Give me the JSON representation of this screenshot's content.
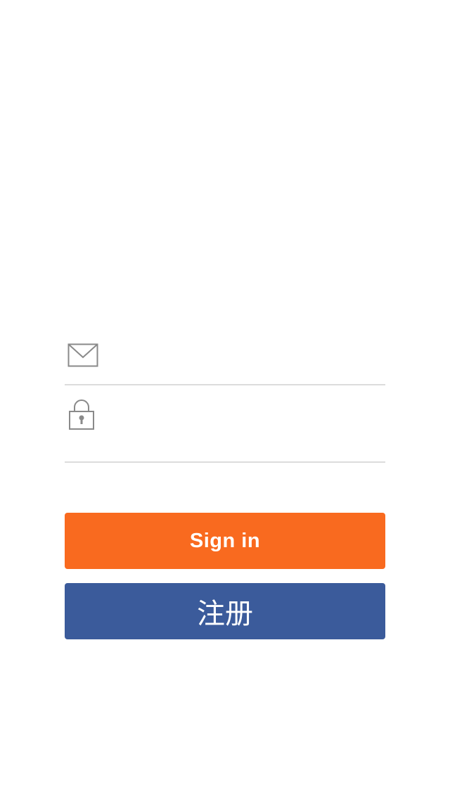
{
  "login_form": {
    "email_field": {
      "icon": "envelope-icon",
      "value": "",
      "placeholder": ""
    },
    "password_field": {
      "icon": "lock-icon",
      "value": "",
      "placeholder": ""
    }
  },
  "actions": {
    "sign_in_label": "Sign in",
    "register_label": "注册"
  },
  "colors": {
    "sign_in_bg": "#f96a1f",
    "register_bg": "#3b5b9b",
    "icon_stroke": "#8a8a8a",
    "divider": "#dcdcdc",
    "background": "#ffffff"
  }
}
